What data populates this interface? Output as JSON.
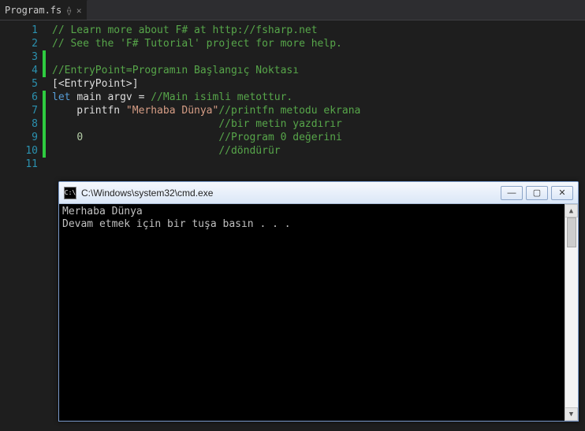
{
  "tab": {
    "filename": "Program.fs",
    "pin_glyph": "⟠",
    "close_glyph": "✕"
  },
  "code_lines": [
    {
      "n": "1",
      "segs": [
        [
          "comment",
          "// Learn more about F# at http://fsharp.net"
        ]
      ]
    },
    {
      "n": "2",
      "segs": [
        [
          "comment",
          "// See the 'F# Tutorial' project for more help."
        ]
      ]
    },
    {
      "n": "3",
      "bar": true,
      "segs": []
    },
    {
      "n": "4",
      "bar": true,
      "segs": [
        [
          "comment",
          "//EntryPoint=Programın Başlangıç Noktası"
        ]
      ]
    },
    {
      "n": "5",
      "segs": [
        [
          "attr",
          "[<EntryPoint>]"
        ]
      ]
    },
    {
      "n": "6",
      "bar": true,
      "segs": [
        [
          "key",
          "let "
        ],
        [
          "ident",
          "main argv = "
        ],
        [
          "comment",
          "//Main isimli metottur."
        ]
      ]
    },
    {
      "n": "7",
      "bar": true,
      "segs": [
        [
          "ident",
          "    printfn "
        ],
        [
          "str",
          "\"Merhaba Dünya\""
        ],
        [
          "comment",
          "//printfn metodu ekrana"
        ]
      ]
    },
    {
      "n": "8",
      "bar": true,
      "segs": [
        [
          "ident",
          "                           "
        ],
        [
          "comment",
          "//bir metin yazdırır"
        ]
      ]
    },
    {
      "n": "9",
      "bar": true,
      "segs": [
        [
          "ident",
          "    "
        ],
        [
          "num",
          "0"
        ],
        [
          "ident",
          "                      "
        ],
        [
          "comment",
          "//Program 0 değerini"
        ]
      ]
    },
    {
      "n": "10",
      "bar": true,
      "segs": [
        [
          "ident",
          "                           "
        ],
        [
          "comment",
          "//döndürür"
        ]
      ]
    },
    {
      "n": "11",
      "segs": []
    }
  ],
  "console": {
    "title": "C:\\Windows\\system32\\cmd.exe",
    "icon_text": "C:\\",
    "min_glyph": "—",
    "max_glyph": "▢",
    "close_glyph": "✕",
    "scroll_up_glyph": "▲",
    "scroll_down_glyph": "▼",
    "lines": [
      "Merhaba Dünya",
      "Devam etmek için bir tuşa basın . . ."
    ]
  }
}
